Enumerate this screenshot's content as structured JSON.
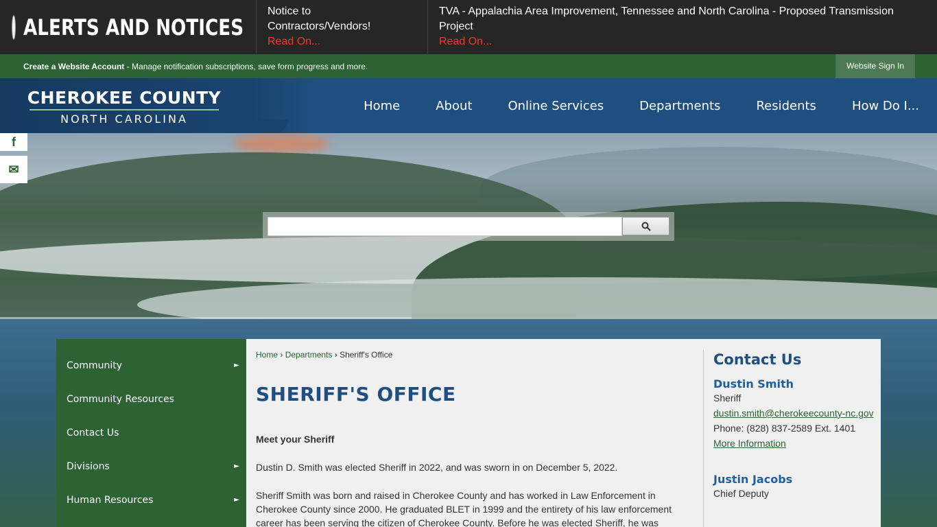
{
  "alerts": {
    "title": "ALERTS AND NOTICES",
    "items": [
      {
        "text": "Notice to Contractors/Vendors!",
        "link": "Read On..."
      },
      {
        "text": "TVA - Appalachia Area Improvement, Tennessee and North Carolina - Proposed Transmission Project",
        "link": "Read On..."
      }
    ]
  },
  "account": {
    "create_label": "Create a Website Account",
    "description": " - Manage notification subscriptions, save form progress and more.",
    "signin_label": "Website Sign In"
  },
  "logo": {
    "main": "CHEROKEE COUNTY",
    "sub": "NORTH CAROLINA"
  },
  "nav": [
    "Home",
    "About",
    "Online Services",
    "Departments",
    "Residents",
    "How Do I..."
  ],
  "social": {
    "facebook_glyph": "f",
    "email_glyph": "✉"
  },
  "search": {
    "placeholder": "",
    "value": ""
  },
  "sidebar": [
    {
      "label": "Community",
      "has_children": true
    },
    {
      "label": "Community Resources",
      "has_children": false
    },
    {
      "label": "Contact Us",
      "has_children": false
    },
    {
      "label": "Divisions",
      "has_children": true
    },
    {
      "label": "Human Resources",
      "has_children": true
    }
  ],
  "breadcrumb": {
    "home": "Home",
    "sep1": " › ",
    "departments": "Departments",
    "sep2": " › ",
    "current": "Sheriff's Office"
  },
  "page_title": "SHERIFF'S OFFICE",
  "content": {
    "heading": "Meet your Sheriff",
    "p1": "Dustin D. Smith was elected Sheriff in 2022, and was sworn in on December 5, 2022.",
    "p2": "Sheriff Smith was born and raised in Cherokee County and has worked in Law Enforcement in Cherokee County since 2000. He graduated BLET in 1999 and the entirety of his law enforcement career has been serving the citizen of Cherokee County. Before he was elected Sheriff, he was"
  },
  "contact": {
    "title": "Contact Us",
    "people": [
      {
        "name": "Dustin Smith",
        "role": "Sheriff",
        "email": "dustin.smith@cherokeecounty-nc.gov",
        "phone": "Phone: (828) 837-2589 Ext. 1401",
        "more": "More Information"
      },
      {
        "name": "Justin Jacobs",
        "role": "Chief Deputy"
      }
    ]
  },
  "colors": {
    "green": "#2c6234",
    "blue": "#1f4f7e",
    "alert_red": "#e8402f"
  }
}
